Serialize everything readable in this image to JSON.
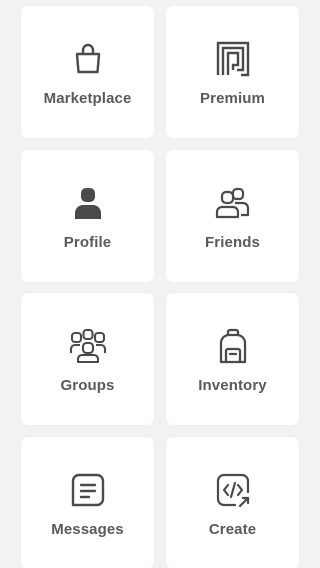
{
  "colors": {
    "background": "#f2f1f3",
    "tile": "#ffffff",
    "icon": "#4a4a4c",
    "label": "#5a5a5c"
  },
  "menu": {
    "items": [
      {
        "label": "Marketplace",
        "icon": "shopping-bag-icon"
      },
      {
        "label": "Premium",
        "icon": "premium-icon"
      },
      {
        "label": "Profile",
        "icon": "profile-icon"
      },
      {
        "label": "Friends",
        "icon": "friends-icon"
      },
      {
        "label": "Groups",
        "icon": "groups-icon"
      },
      {
        "label": "Inventory",
        "icon": "backpack-icon"
      },
      {
        "label": "Messages",
        "icon": "message-icon"
      },
      {
        "label": "Create",
        "icon": "code-icon"
      }
    ]
  }
}
